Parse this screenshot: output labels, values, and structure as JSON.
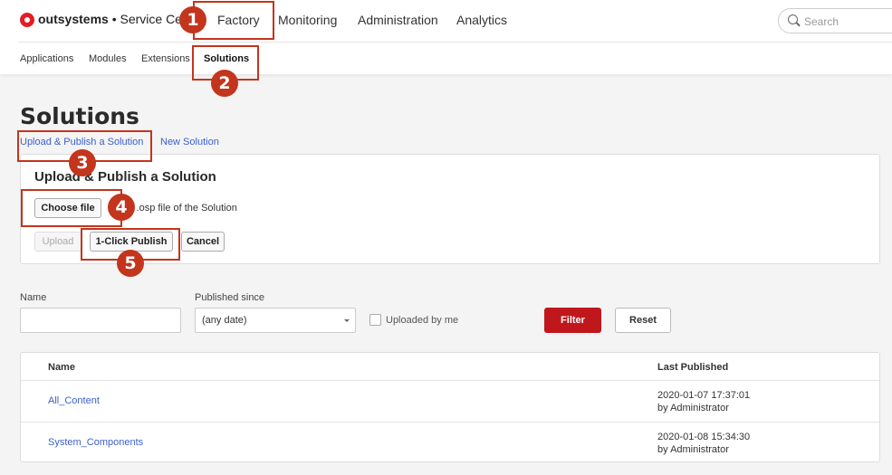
{
  "header": {
    "brand": "outsystems",
    "product": "• Service Center",
    "nav": [
      "Factory",
      "Monitoring",
      "Administration",
      "Analytics"
    ],
    "search_placeholder": "Search",
    "icons": {
      "logo": "outsystems-logo",
      "search": "search-icon"
    }
  },
  "subnav": [
    "Applications",
    "Modules",
    "Extensions",
    "Solutions"
  ],
  "page": {
    "title": "Solutions",
    "links": [
      "Upload & Publish a Solution",
      "New Solution"
    ]
  },
  "upload_panel": {
    "title": "Upload & Publish a Solution",
    "choose_file_label": "Choose file",
    "file_hint": "o the .osp file of the Solution",
    "upload_label": "Upload",
    "one_click_label": "1-Click Publish",
    "cancel_label": "Cancel"
  },
  "annotations": [
    "1",
    "2",
    "3",
    "4",
    "5"
  ],
  "filters": {
    "name_label": "Name",
    "name_value": "",
    "published_since_label": "Published since",
    "published_since_value": "(any date)",
    "uploaded_by_me_label": "Uploaded by me",
    "uploaded_by_me_checked": false,
    "filter_label": "Filter",
    "reset_label": "Reset"
  },
  "table": {
    "columns": [
      "Name",
      "Last Published"
    ],
    "rows": [
      {
        "name": "All_Content",
        "date": "2020-01-07 17:37:01",
        "by": "by Administrator"
      },
      {
        "name": "System_Components",
        "date": "2020-01-08 15:34:30",
        "by": "by Administrator"
      }
    ]
  },
  "colors": {
    "accent": "#c0171c",
    "annotation": "#c3351d",
    "link": "#3a5fcd"
  }
}
